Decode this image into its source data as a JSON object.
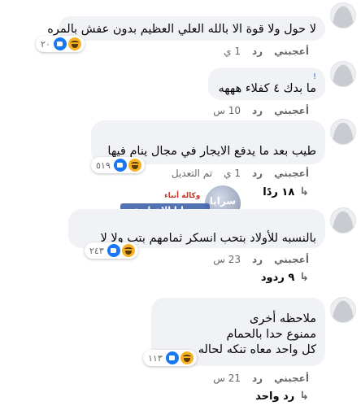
{
  "comments": [
    {
      "text": "لا حول ولا قوة الا بالله العلي العظيم بدون عفش بالمره",
      "like_label": "أعجبني",
      "reply_label": "رد",
      "time": "1 ي",
      "reaction_count": "٢٠"
    },
    {
      "name_mark": "!",
      "text": "ما بدك ٤ كفلاء هههه",
      "like_label": "أعجبني",
      "reply_label": "رد",
      "time": "10 س"
    },
    {
      "text": "طيب بعد ما يدفع الايجار في مجال ينام فيها",
      "like_label": "أعجبني",
      "reply_label": "رد",
      "time": "1 ي",
      "edited": "تم التعديل",
      "reaction_count": "٥١٩",
      "replies_label": "١٨ ردًا"
    },
    {
      "text": "بالنسبه للأولاد بتحب انسكر ثمامهم بتب ولا لا",
      "like_label": "أعجبني",
      "reply_label": "رد",
      "time": "23 س",
      "reaction_count": "٢٤٣",
      "replies_label": "٩ ردود"
    },
    {
      "line1": "ملاحظه أخرى",
      "line2": "ممنوع حدا     بالحمام",
      "line3": "كل واحد معاه تنكه لحاله",
      "like_label": "أعجبني",
      "reply_label": "رد",
      "time": "21 س",
      "reaction_count": "١١٣",
      "replies_label": "رد واحد"
    }
  ],
  "watermark": {
    "logo": "سرايا",
    "band": "سرايا الإخبارية",
    "top": "وكالة أنباء"
  }
}
